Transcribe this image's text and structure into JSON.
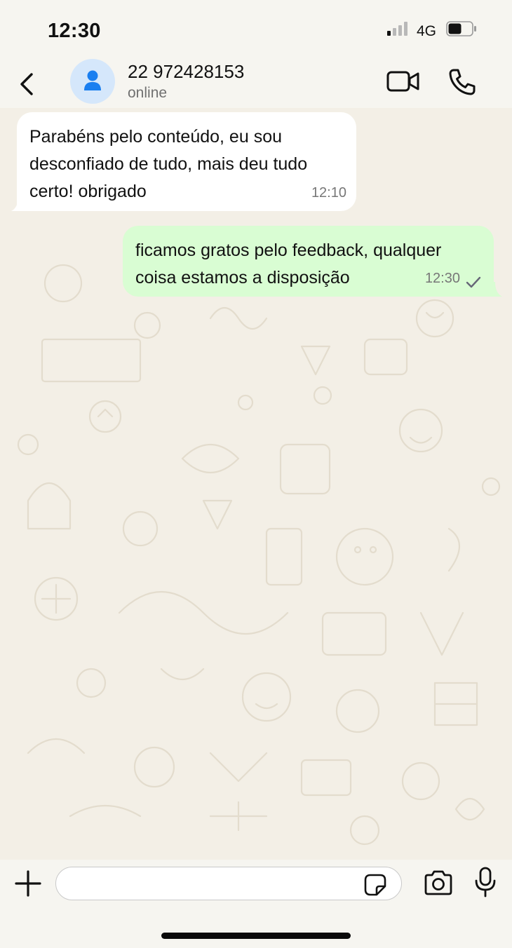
{
  "status_bar": {
    "time": "12:30",
    "network": "4G",
    "icons": [
      "signal-icon",
      "battery-icon"
    ]
  },
  "header": {
    "contact_name": "22 972428153",
    "contact_status": "online",
    "icons": [
      "back-icon",
      "user-icon",
      "video-camera-icon",
      "phone-icon"
    ]
  },
  "messages": [
    {
      "direction": "incoming",
      "text": "Parabéns pelo conteúdo, eu sou desconfiado de tudo, mais deu tudo certo! obrigado",
      "time": "12:10"
    },
    {
      "direction": "outgoing",
      "text": "ficamos gratos pelo feedback, qualquer coisa estamos a disposição",
      "time": "12:30",
      "status_icon": "check-icon"
    }
  ],
  "composer": {
    "value": "",
    "icons": [
      "plus-icon",
      "sticker-icon",
      "camera-icon",
      "microphone-icon"
    ]
  },
  "colors": {
    "background": "#f6f5f0",
    "wallpaper": "#f3efe6",
    "incoming_bubble": "#ffffff",
    "outgoing_bubble": "#d9fdd3",
    "avatar_bg": "#d5e7fb",
    "accent": "#1a7ff0"
  }
}
